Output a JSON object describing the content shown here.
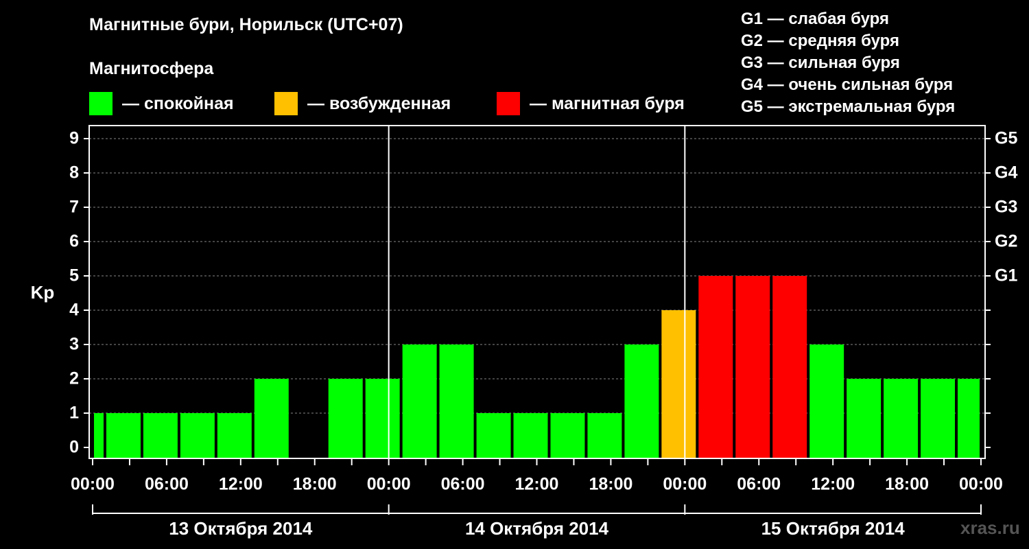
{
  "header": {
    "title": "Магнитные бури, Норильск (UTC+07)",
    "subtitle": "Магнитосфера"
  },
  "legend": [
    {
      "label": "— спокойная",
      "color": "#00ff00"
    },
    {
      "label": "— возбужденная",
      "color": "#ffc000"
    },
    {
      "label": "— магнитная буря",
      "color": "#ff0000"
    }
  ],
  "storm_levels": [
    "G1 — слабая буря",
    "G2 — средняя буря",
    "G3 — сильная буря",
    "G4 — очень сильная буря",
    "G5 — экстремальная буря"
  ],
  "watermark": "xras.ru",
  "colors": {
    "quiet": "#00ff00",
    "active": "#ffc000",
    "storm": "#ff0000",
    "background": "#000000",
    "grid": "#888888"
  },
  "chart_data": {
    "type": "bar",
    "ylabel": "Kp",
    "ylim": [
      0,
      9
    ],
    "yticks": [
      "0",
      "1",
      "2",
      "3",
      "4",
      "5",
      "6",
      "7",
      "8",
      "9"
    ],
    "right_ticks": [
      {
        "kp": 5,
        "label": "G1"
      },
      {
        "kp": 6,
        "label": "G2"
      },
      {
        "kp": 7,
        "label": "G3"
      },
      {
        "kp": 8,
        "label": "G4"
      },
      {
        "kp": 9,
        "label": "G5"
      }
    ],
    "xlim_hours": [
      0,
      72
    ],
    "xtick_labels": [
      "00:00",
      "06:00",
      "12:00",
      "18:00",
      "00:00",
      "06:00",
      "12:00",
      "18:00",
      "00:00",
      "06:00",
      "12:00",
      "18:00",
      "00:00"
    ],
    "days": [
      "13 Октября 2014",
      "14 Октября 2014",
      "15 Октября 2014"
    ],
    "grid": "horizontal dashed",
    "bars": [
      {
        "start": 0,
        "end": 1,
        "kp": 1,
        "level": "quiet"
      },
      {
        "start": 1,
        "end": 4,
        "kp": 1,
        "level": "quiet"
      },
      {
        "start": 4,
        "end": 7,
        "kp": 1,
        "level": "quiet"
      },
      {
        "start": 7,
        "end": 10,
        "kp": 1,
        "level": "quiet"
      },
      {
        "start": 10,
        "end": 13,
        "kp": 1,
        "level": "quiet"
      },
      {
        "start": 13,
        "end": 16,
        "kp": 2,
        "level": "quiet"
      },
      {
        "start": 19,
        "end": 22,
        "kp": 2,
        "level": "quiet"
      },
      {
        "start": 22,
        "end": 25,
        "kp": 2,
        "level": "quiet"
      },
      {
        "start": 25,
        "end": 28,
        "kp": 3,
        "level": "quiet"
      },
      {
        "start": 28,
        "end": 31,
        "kp": 3,
        "level": "quiet"
      },
      {
        "start": 31,
        "end": 34,
        "kp": 1,
        "level": "quiet"
      },
      {
        "start": 34,
        "end": 37,
        "kp": 1,
        "level": "quiet"
      },
      {
        "start": 37,
        "end": 40,
        "kp": 1,
        "level": "quiet"
      },
      {
        "start": 40,
        "end": 43,
        "kp": 1,
        "level": "quiet"
      },
      {
        "start": 43,
        "end": 46,
        "kp": 3,
        "level": "quiet"
      },
      {
        "start": 46,
        "end": 49,
        "kp": 4,
        "level": "active"
      },
      {
        "start": 49,
        "end": 52,
        "kp": 5,
        "level": "storm"
      },
      {
        "start": 52,
        "end": 55,
        "kp": 5,
        "level": "storm"
      },
      {
        "start": 55,
        "end": 58,
        "kp": 5,
        "level": "storm"
      },
      {
        "start": 58,
        "end": 61,
        "kp": 3,
        "level": "quiet"
      },
      {
        "start": 61,
        "end": 64,
        "kp": 2,
        "level": "quiet"
      },
      {
        "start": 64,
        "end": 67,
        "kp": 2,
        "level": "quiet"
      },
      {
        "start": 67,
        "end": 70,
        "kp": 2,
        "level": "quiet"
      },
      {
        "start": 70,
        "end": 72,
        "kp": 2,
        "level": "quiet"
      }
    ]
  }
}
